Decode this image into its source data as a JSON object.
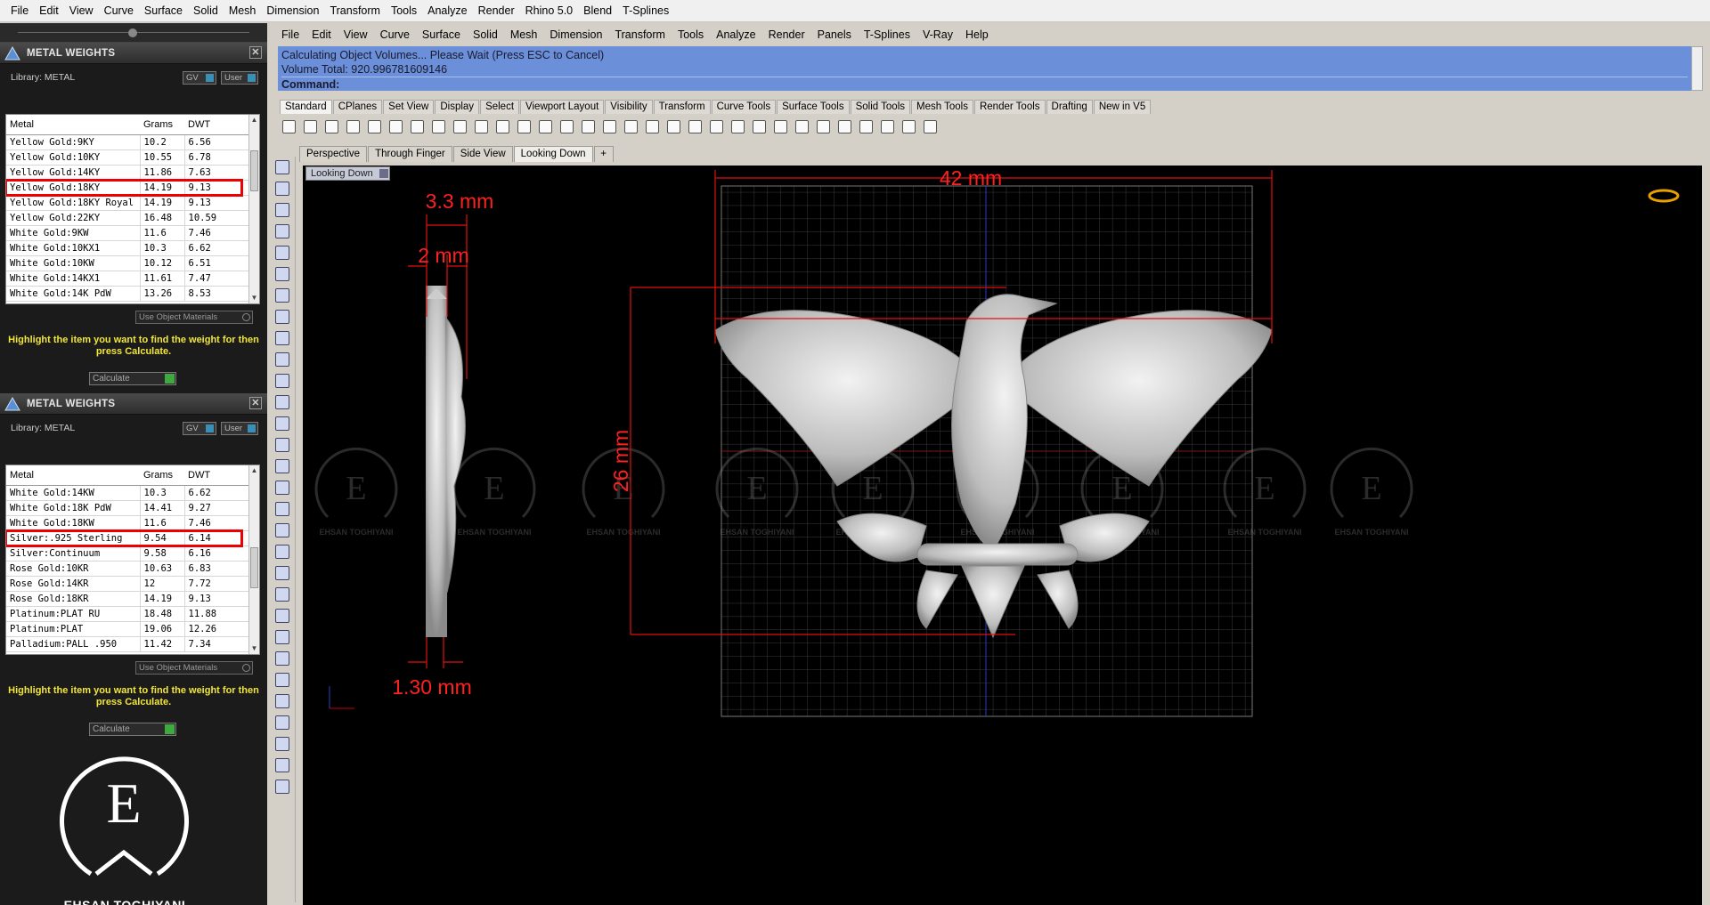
{
  "top_menu": [
    "File",
    "Edit",
    "View",
    "Curve",
    "Surface",
    "Solid",
    "Mesh",
    "Dimension",
    "Transform",
    "Tools",
    "Analyze",
    "Render",
    "Rhino 5.0",
    "Blend",
    "T-Splines"
  ],
  "panel1": {
    "title": "METAL WEIGHTS",
    "library": "Library: METAL",
    "gv": "GV",
    "user": "User",
    "headers": [
      "Metal",
      "Grams",
      "DWT"
    ],
    "rows": [
      [
        "Yellow Gold:9KY",
        "10.2",
        "6.56"
      ],
      [
        "Yellow Gold:10KY",
        "10.55",
        "6.78"
      ],
      [
        "Yellow Gold:14KY",
        "11.86",
        "7.63"
      ],
      [
        "Yellow Gold:18KY",
        "14.19",
        "9.13"
      ],
      [
        "Yellow Gold:18KY Royal",
        "14.19",
        "9.13"
      ],
      [
        "Yellow Gold:22KY",
        "16.48",
        "10.59"
      ],
      [
        "White Gold:9KW",
        "11.6",
        "7.46"
      ],
      [
        "White Gold:10KX1",
        "10.3",
        "6.62"
      ],
      [
        "White Gold:10KW",
        "10.12",
        "6.51"
      ],
      [
        "White Gold:14KX1",
        "11.61",
        "7.47"
      ],
      [
        "White Gold:14K PdW",
        "13.26",
        "8.53"
      ]
    ],
    "use_obj": "Use Object Materials",
    "hint": "Highlight the item you want to find the weight for then press Calculate.",
    "calc": "Calculate"
  },
  "panel2": {
    "title": "METAL WEIGHTS",
    "library": "Library: METAL",
    "gv": "GV",
    "user": "User",
    "headers": [
      "Metal",
      "Grams",
      "DWT"
    ],
    "rows": [
      [
        "White Gold:14KW",
        "10.3",
        "6.62"
      ],
      [
        "White Gold:18K PdW",
        "14.41",
        "9.27"
      ],
      [
        "White Gold:18KW",
        "11.6",
        "7.46"
      ],
      [
        "Silver:.925 Sterling",
        "9.54",
        "6.14"
      ],
      [
        "Silver:Continuum",
        "9.58",
        "6.16"
      ],
      [
        "Rose Gold:10KR",
        "10.63",
        "6.83"
      ],
      [
        "Rose Gold:14KR",
        "12",
        "7.72"
      ],
      [
        "Rose Gold:18KR",
        "14.19",
        "9.13"
      ],
      [
        "Platinum:PLAT RU",
        "18.48",
        "11.88"
      ],
      [
        "Platinum:PLAT",
        "19.06",
        "12.26"
      ],
      [
        "Palladium:PALL .950",
        "11.42",
        "7.34"
      ]
    ],
    "use_obj": "Use Object Materials",
    "hint": "Highlight the item you want to find the weight for then press Calculate.",
    "calc": "Calculate"
  },
  "brand": {
    "letter": "E",
    "name": "EHSAN TOGHIYANI"
  },
  "rhino_menu": [
    "File",
    "Edit",
    "View",
    "Curve",
    "Surface",
    "Solid",
    "Mesh",
    "Dimension",
    "Transform",
    "Tools",
    "Analyze",
    "Render",
    "Panels",
    "T-Splines",
    "V-Ray",
    "Help"
  ],
  "command": {
    "line1": "Calculating Object Volumes... Please Wait (Press ESC to Cancel)",
    "line2": "Volume Total: 920.996781609146",
    "prompt": "Command:"
  },
  "toolbar_tabs": [
    "Standard",
    "CPlanes",
    "Set View",
    "Display",
    "Select",
    "Viewport Layout",
    "Visibility",
    "Transform",
    "Curve Tools",
    "Surface Tools",
    "Solid Tools",
    "Mesh Tools",
    "Render Tools",
    "Drafting",
    "New in V5"
  ],
  "view_tabs": [
    "Perspective",
    "Through Finger",
    "Side View",
    "Looking Down"
  ],
  "viewport_label": "Looking Down",
  "dimensions": {
    "width": "42 mm",
    "thick": "3.3 mm",
    "thin": "2 mm",
    "height": "26 mm",
    "base": "1.30 mm"
  },
  "watermark": "EHSAN TOGHIYANI",
  "colors": {
    "highlight": "#ee0000",
    "dim": "#e01010",
    "hint": "#f2e63a",
    "command_bg": "#6b8fd8"
  }
}
